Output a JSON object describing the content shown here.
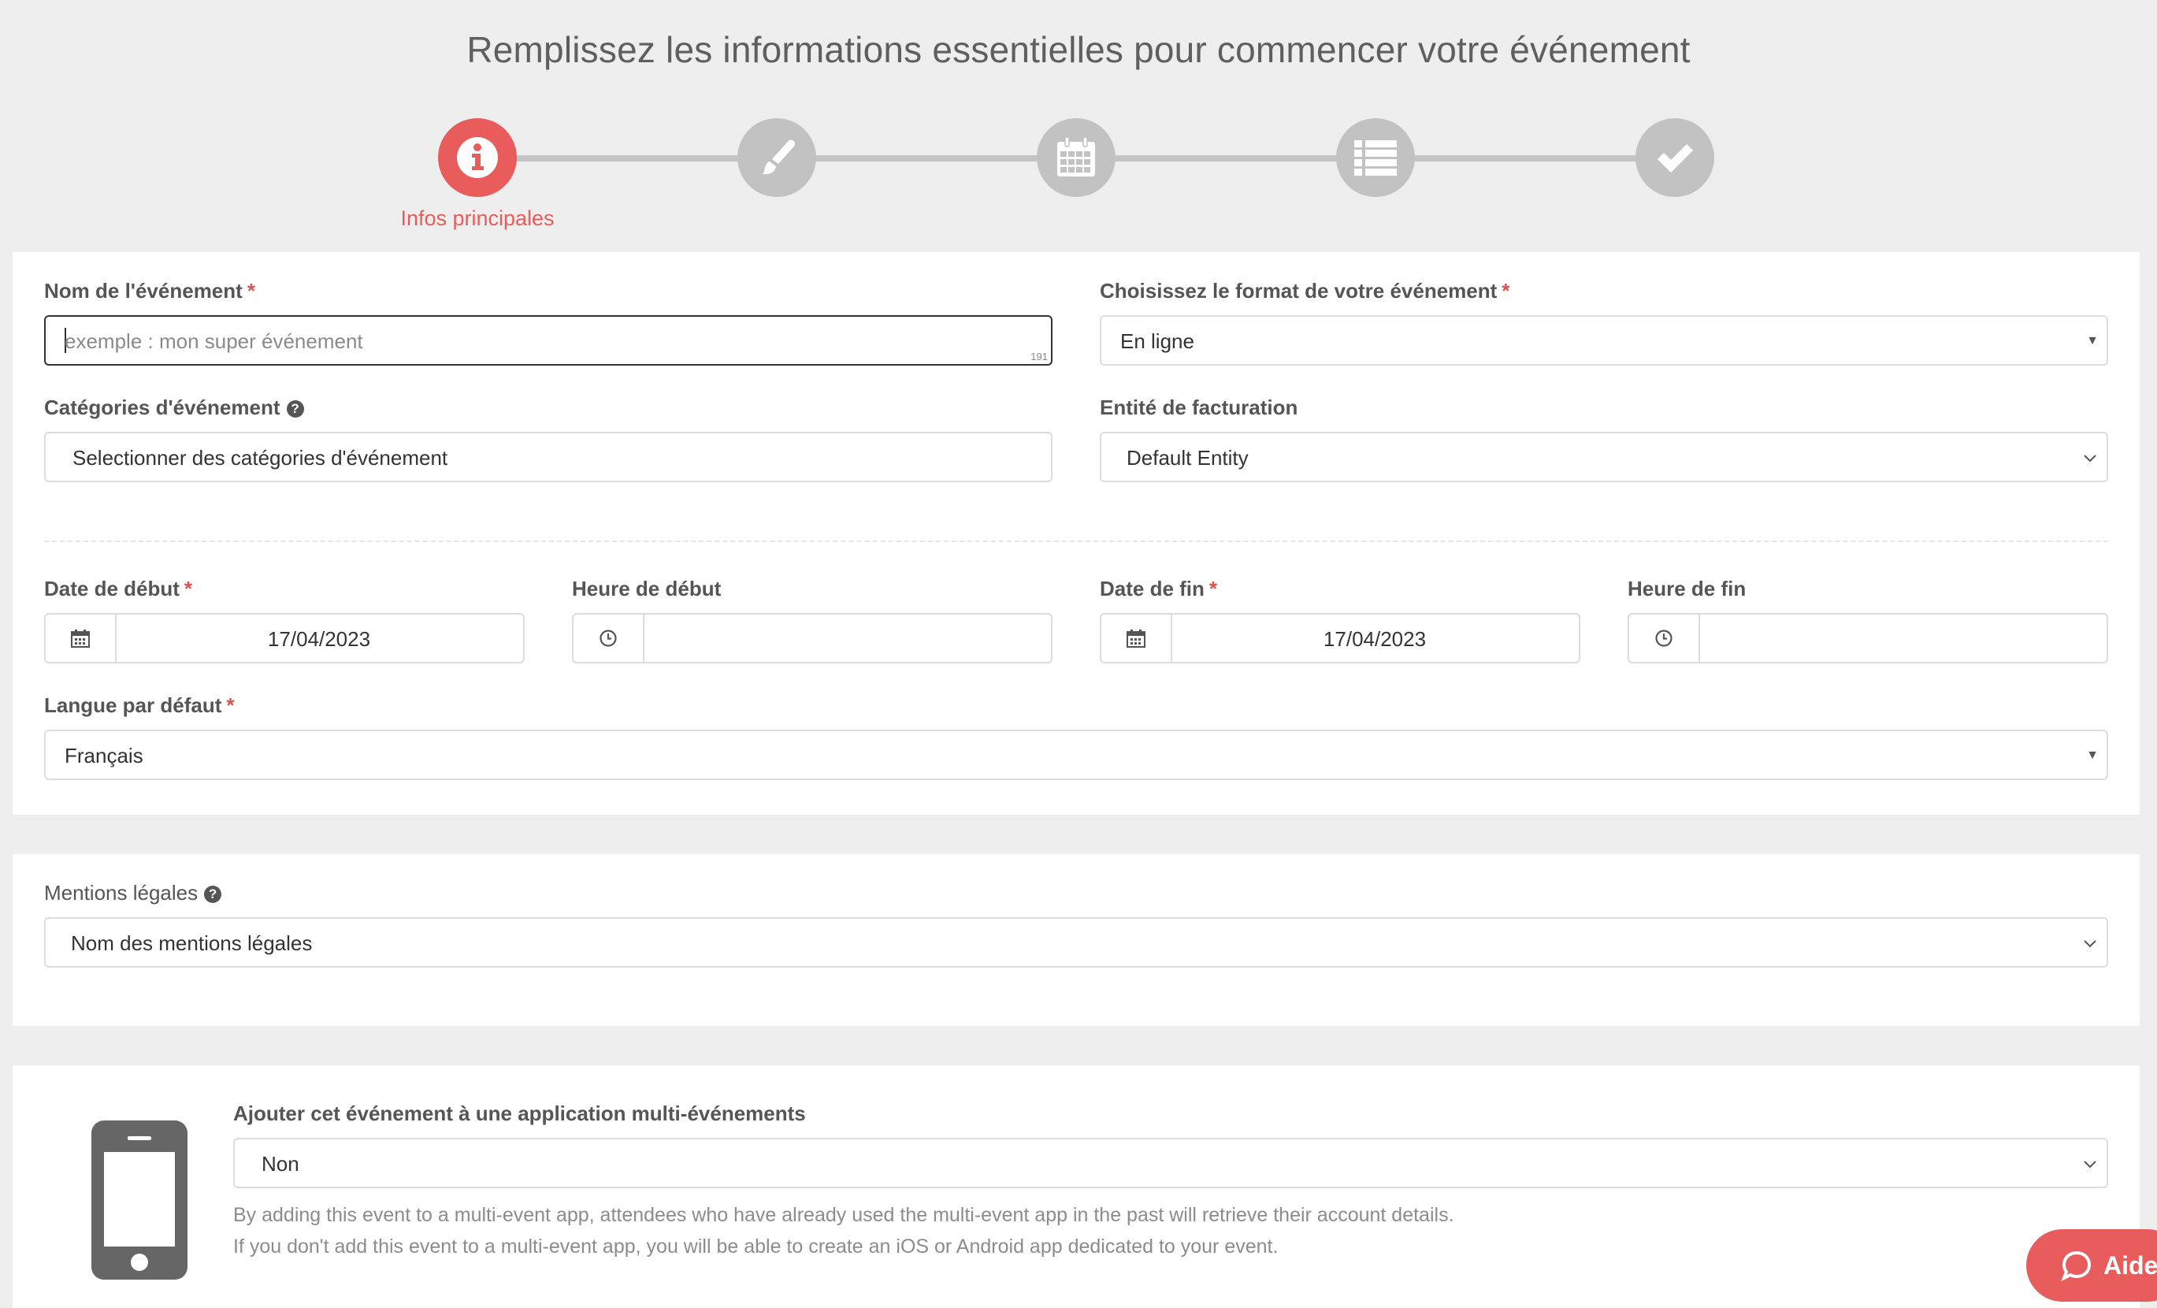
{
  "header": {
    "title": "Remplissez les informations essentielles pour commencer votre événement"
  },
  "stepper": {
    "active_label": "Infos principales",
    "steps": [
      {
        "icon": "info-icon",
        "active": true
      },
      {
        "icon": "brush-icon",
        "active": false
      },
      {
        "icon": "calendar-icon",
        "active": false
      },
      {
        "icon": "list-icon",
        "active": false
      },
      {
        "icon": "check-icon",
        "active": false
      }
    ]
  },
  "form": {
    "event_name": {
      "label": "Nom de l'événement",
      "required_mark": "*",
      "placeholder": "exemple : mon super événement",
      "value": "",
      "counter": "191"
    },
    "event_format": {
      "label": "Choisissez le format de votre événement",
      "required_mark": "*",
      "value": "En ligne"
    },
    "categories": {
      "label": "Catégories d'événement",
      "placeholder": "Selectionner des catégories d'événement"
    },
    "billing_entity": {
      "label": "Entité de facturation",
      "value": "Default Entity"
    },
    "start_date": {
      "label": "Date de début",
      "required_mark": "*",
      "value": "17/04/2023"
    },
    "start_time": {
      "label": "Heure de début",
      "value": ""
    },
    "end_date": {
      "label": "Date de fin",
      "required_mark": "*",
      "value": "17/04/2023"
    },
    "end_time": {
      "label": "Heure de fin",
      "value": ""
    },
    "default_language": {
      "label": "Langue par défaut",
      "required_mark": "*",
      "value": "Français"
    }
  },
  "legal": {
    "label": "Mentions légales",
    "value": "Nom des mentions légales"
  },
  "multi_event": {
    "label": "Ajouter cet événement à une application multi-événements",
    "value": "Non",
    "help_line_1": "By adding this event to a multi-event app, attendees who have already used the multi-event app in the past will retrieve their account details.",
    "help_line_2": "If you don't add this event to a multi-event app, you will be able to create an iOS or Android app dedicated to your event."
  },
  "help_button": {
    "label": "Aide"
  },
  "colors": {
    "accent": "#e85c5c",
    "inactive_step": "#c2c2c2",
    "background": "#eeeeee",
    "panel": "#ffffff"
  }
}
